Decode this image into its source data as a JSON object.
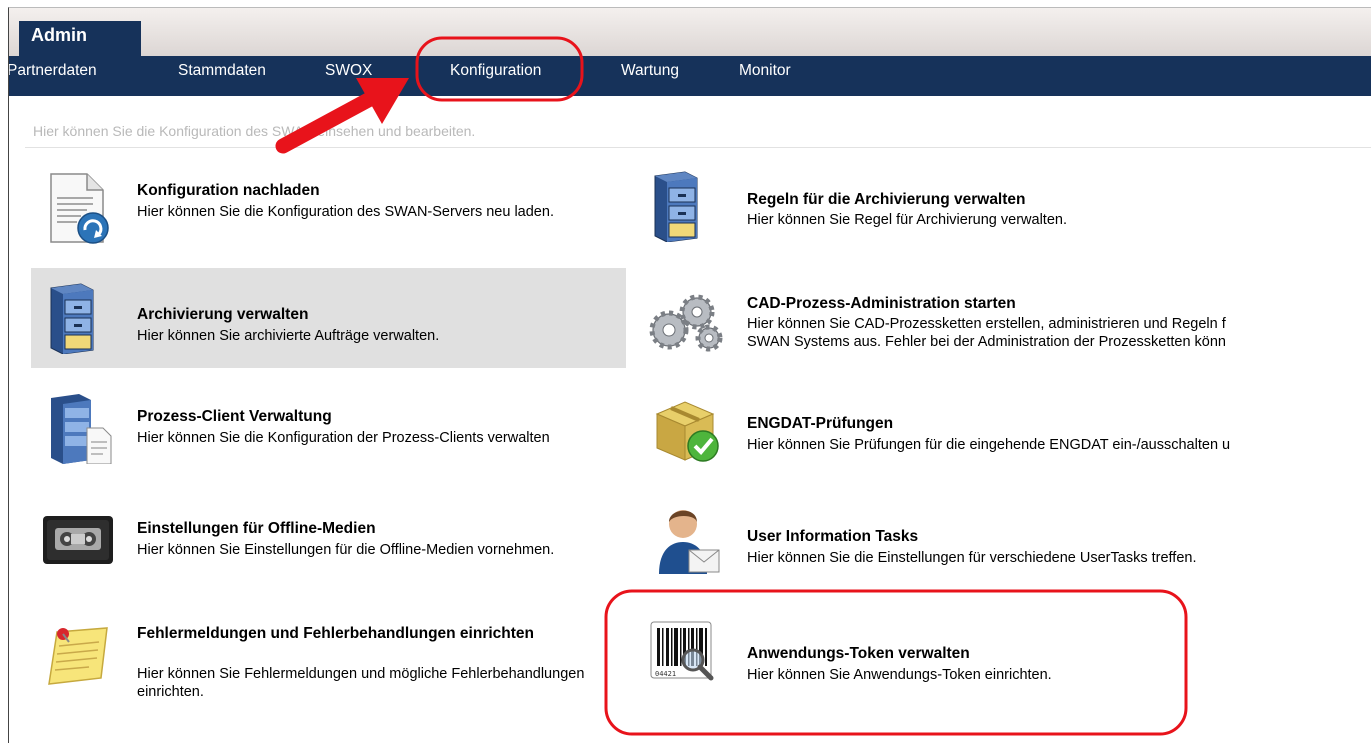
{
  "tabs": {
    "active": "Admin"
  },
  "nav": {
    "items": [
      "Partnerdaten",
      "Stammdaten",
      "SWOX",
      "Konfiguration",
      "Wartung",
      "Monitor"
    ]
  },
  "page": {
    "hint": "Hier können Sie die Konfiguration des SWAN einsehen und bearbeiten."
  },
  "left_items": [
    {
      "title": "Konfiguration nachladen",
      "desc": "Hier können Sie die Konfiguration des SWAN-Servers neu laden.",
      "icon": "document-reload-icon"
    },
    {
      "title": "Archivierung verwalten",
      "desc": "Hier können Sie archivierte Aufträge verwalten.",
      "icon": "archive-cabinet-icon",
      "selected": true
    },
    {
      "title": "Prozess-Client Verwaltung",
      "desc": "Hier können Sie die Konfiguration der Prozess-Clients verwalten",
      "icon": "server-document-icon"
    },
    {
      "title": "Einstellungen für Offline-Medien",
      "desc": "Hier können Sie Einstellungen für die Offline-Medien vornehmen.",
      "icon": "tape-cassette-icon"
    },
    {
      "title": "Fehlermeldungen und Fehlerbehandlungen einrichten",
      "desc": "Hier können Sie Fehlermeldungen und mögliche Fehlerbehandlungen einrichten.",
      "icon": "sticky-note-icon"
    }
  ],
  "right_items": [
    {
      "title": "Regeln für die Archivierung verwalten",
      "desc": "Hier können Sie Regel für Archivierung verwalten.",
      "icon": "archive-cabinet-icon"
    },
    {
      "title": "CAD-Prozess-Administration starten",
      "desc": "Hier können Sie CAD-Prozessketten erstellen, administrieren und Regeln f",
      "desc2": "SWAN Systems aus. Fehler bei der Administration der Prozessketten könn",
      "icon": "gears-icon"
    },
    {
      "title": "ENGDAT-Prüfungen",
      "desc": "Hier können Sie Prüfungen für die eingehende ENGDAT ein-/ausschalten u",
      "icon": "package-check-icon"
    },
    {
      "title": "User Information Tasks",
      "desc": "Hier können Sie die Einstellungen für verschiedene UserTasks treffen.",
      "icon": "user-mail-icon"
    },
    {
      "title": "Anwendungs-Token verwalten",
      "desc": "Hier können Sie Anwendungs-Token einrichten.",
      "icon": "barcode-search-icon",
      "barcode_text": "04421"
    }
  ],
  "colors": {
    "nav_bg": "#16325a",
    "highlight": "#e8131b",
    "selected_bg": "#e0e0e0"
  }
}
